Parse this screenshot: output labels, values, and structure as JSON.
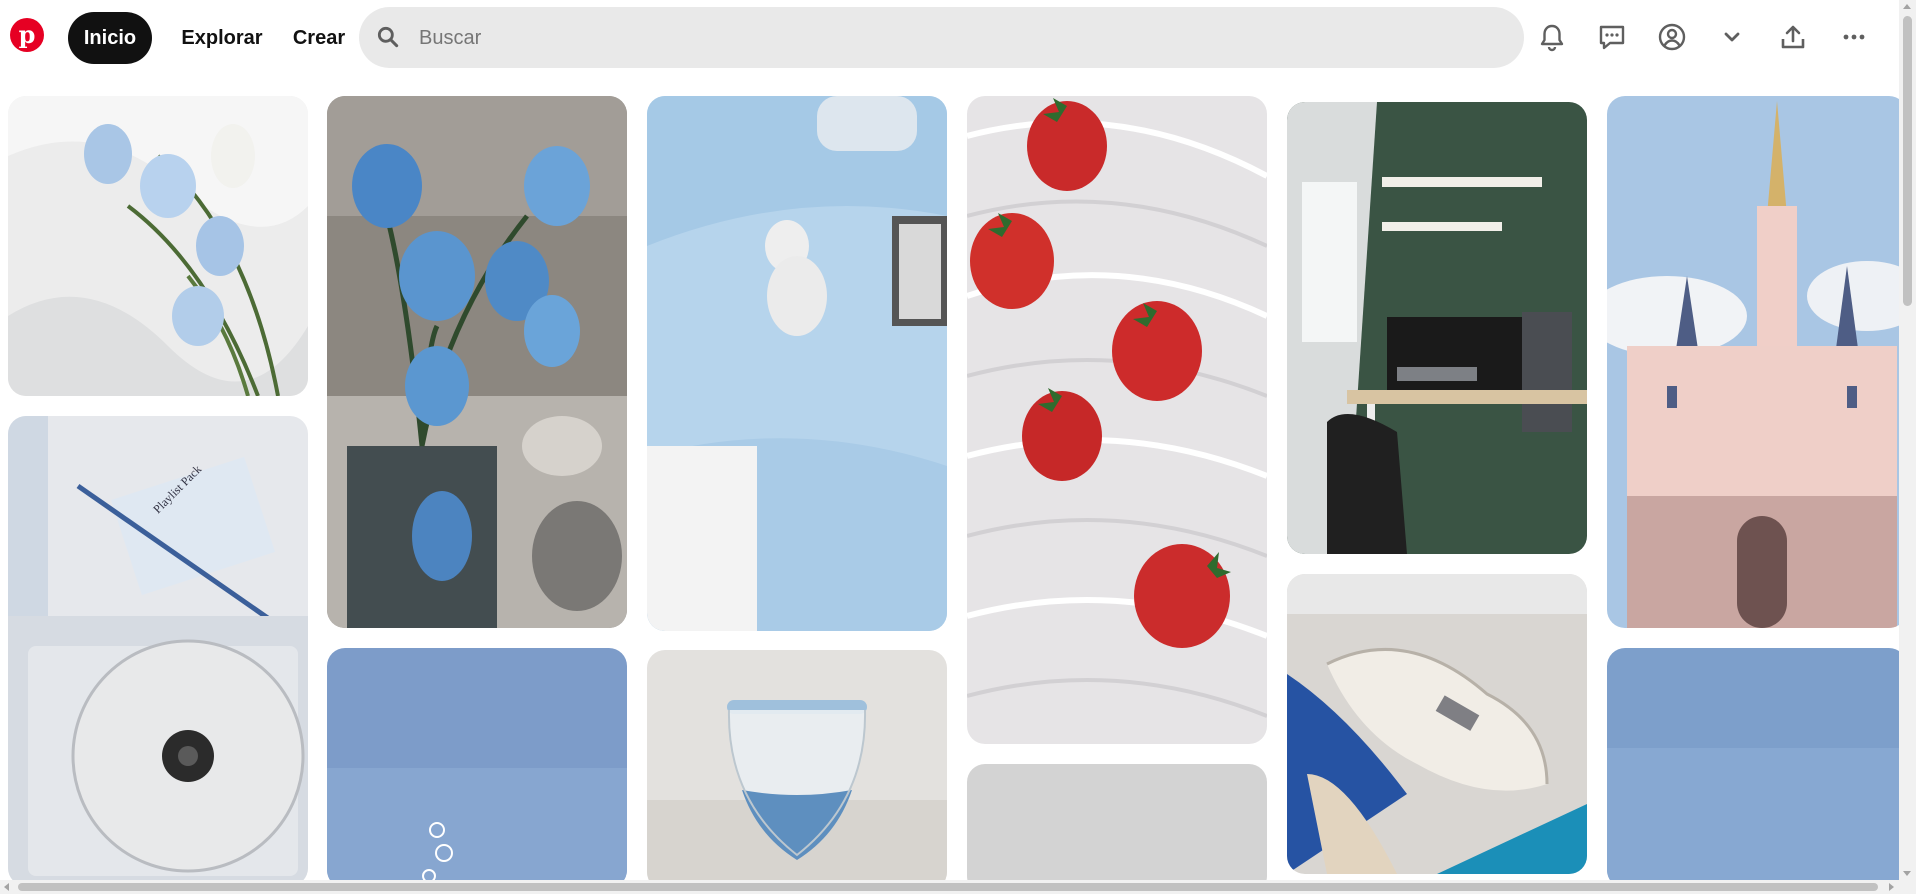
{
  "header": {
    "logo_icon": "pinterest-logo-icon",
    "logo_letter": "p",
    "nav": {
      "home": "Inicio",
      "explore": "Explorar",
      "create": "Crear"
    },
    "search": {
      "placeholder": "Buscar",
      "value": "",
      "icon": "search-icon"
    },
    "icons": [
      "bell-icon",
      "chat-bubble-icon",
      "user-circle-icon",
      "chevron-down-icon",
      "share-upload-icon",
      "more-horizontal-icon"
    ]
  },
  "pins": [
    {
      "subject": "blue-white-tulips-on-white-cloth"
    },
    {
      "subject": "blue-tulips-in-glass-vase"
    },
    {
      "subject": "light-blue-bedding-with-plush-bunny"
    },
    {
      "subject": "strawberries-in-water-splash"
    },
    {
      "subject": "desk-setup-green-wall"
    },
    {
      "subject": "pink-castle"
    },
    {
      "subject": "white-cd-player",
      "printed_text": "Playlist Pack"
    },
    {
      "subject": "blue-sky-bubbles"
    },
    {
      "subject": "blue-sand-hourglass"
    },
    {
      "subject": "grey-placeholder"
    },
    {
      "subject": "white-sneaker-in-hand"
    },
    {
      "subject": "blue-sky"
    }
  ],
  "colors": {
    "brand": "#e60023",
    "active_nav_bg": "#111111",
    "search_bg": "#e9e9e9",
    "icon": "#5f5f5f"
  }
}
